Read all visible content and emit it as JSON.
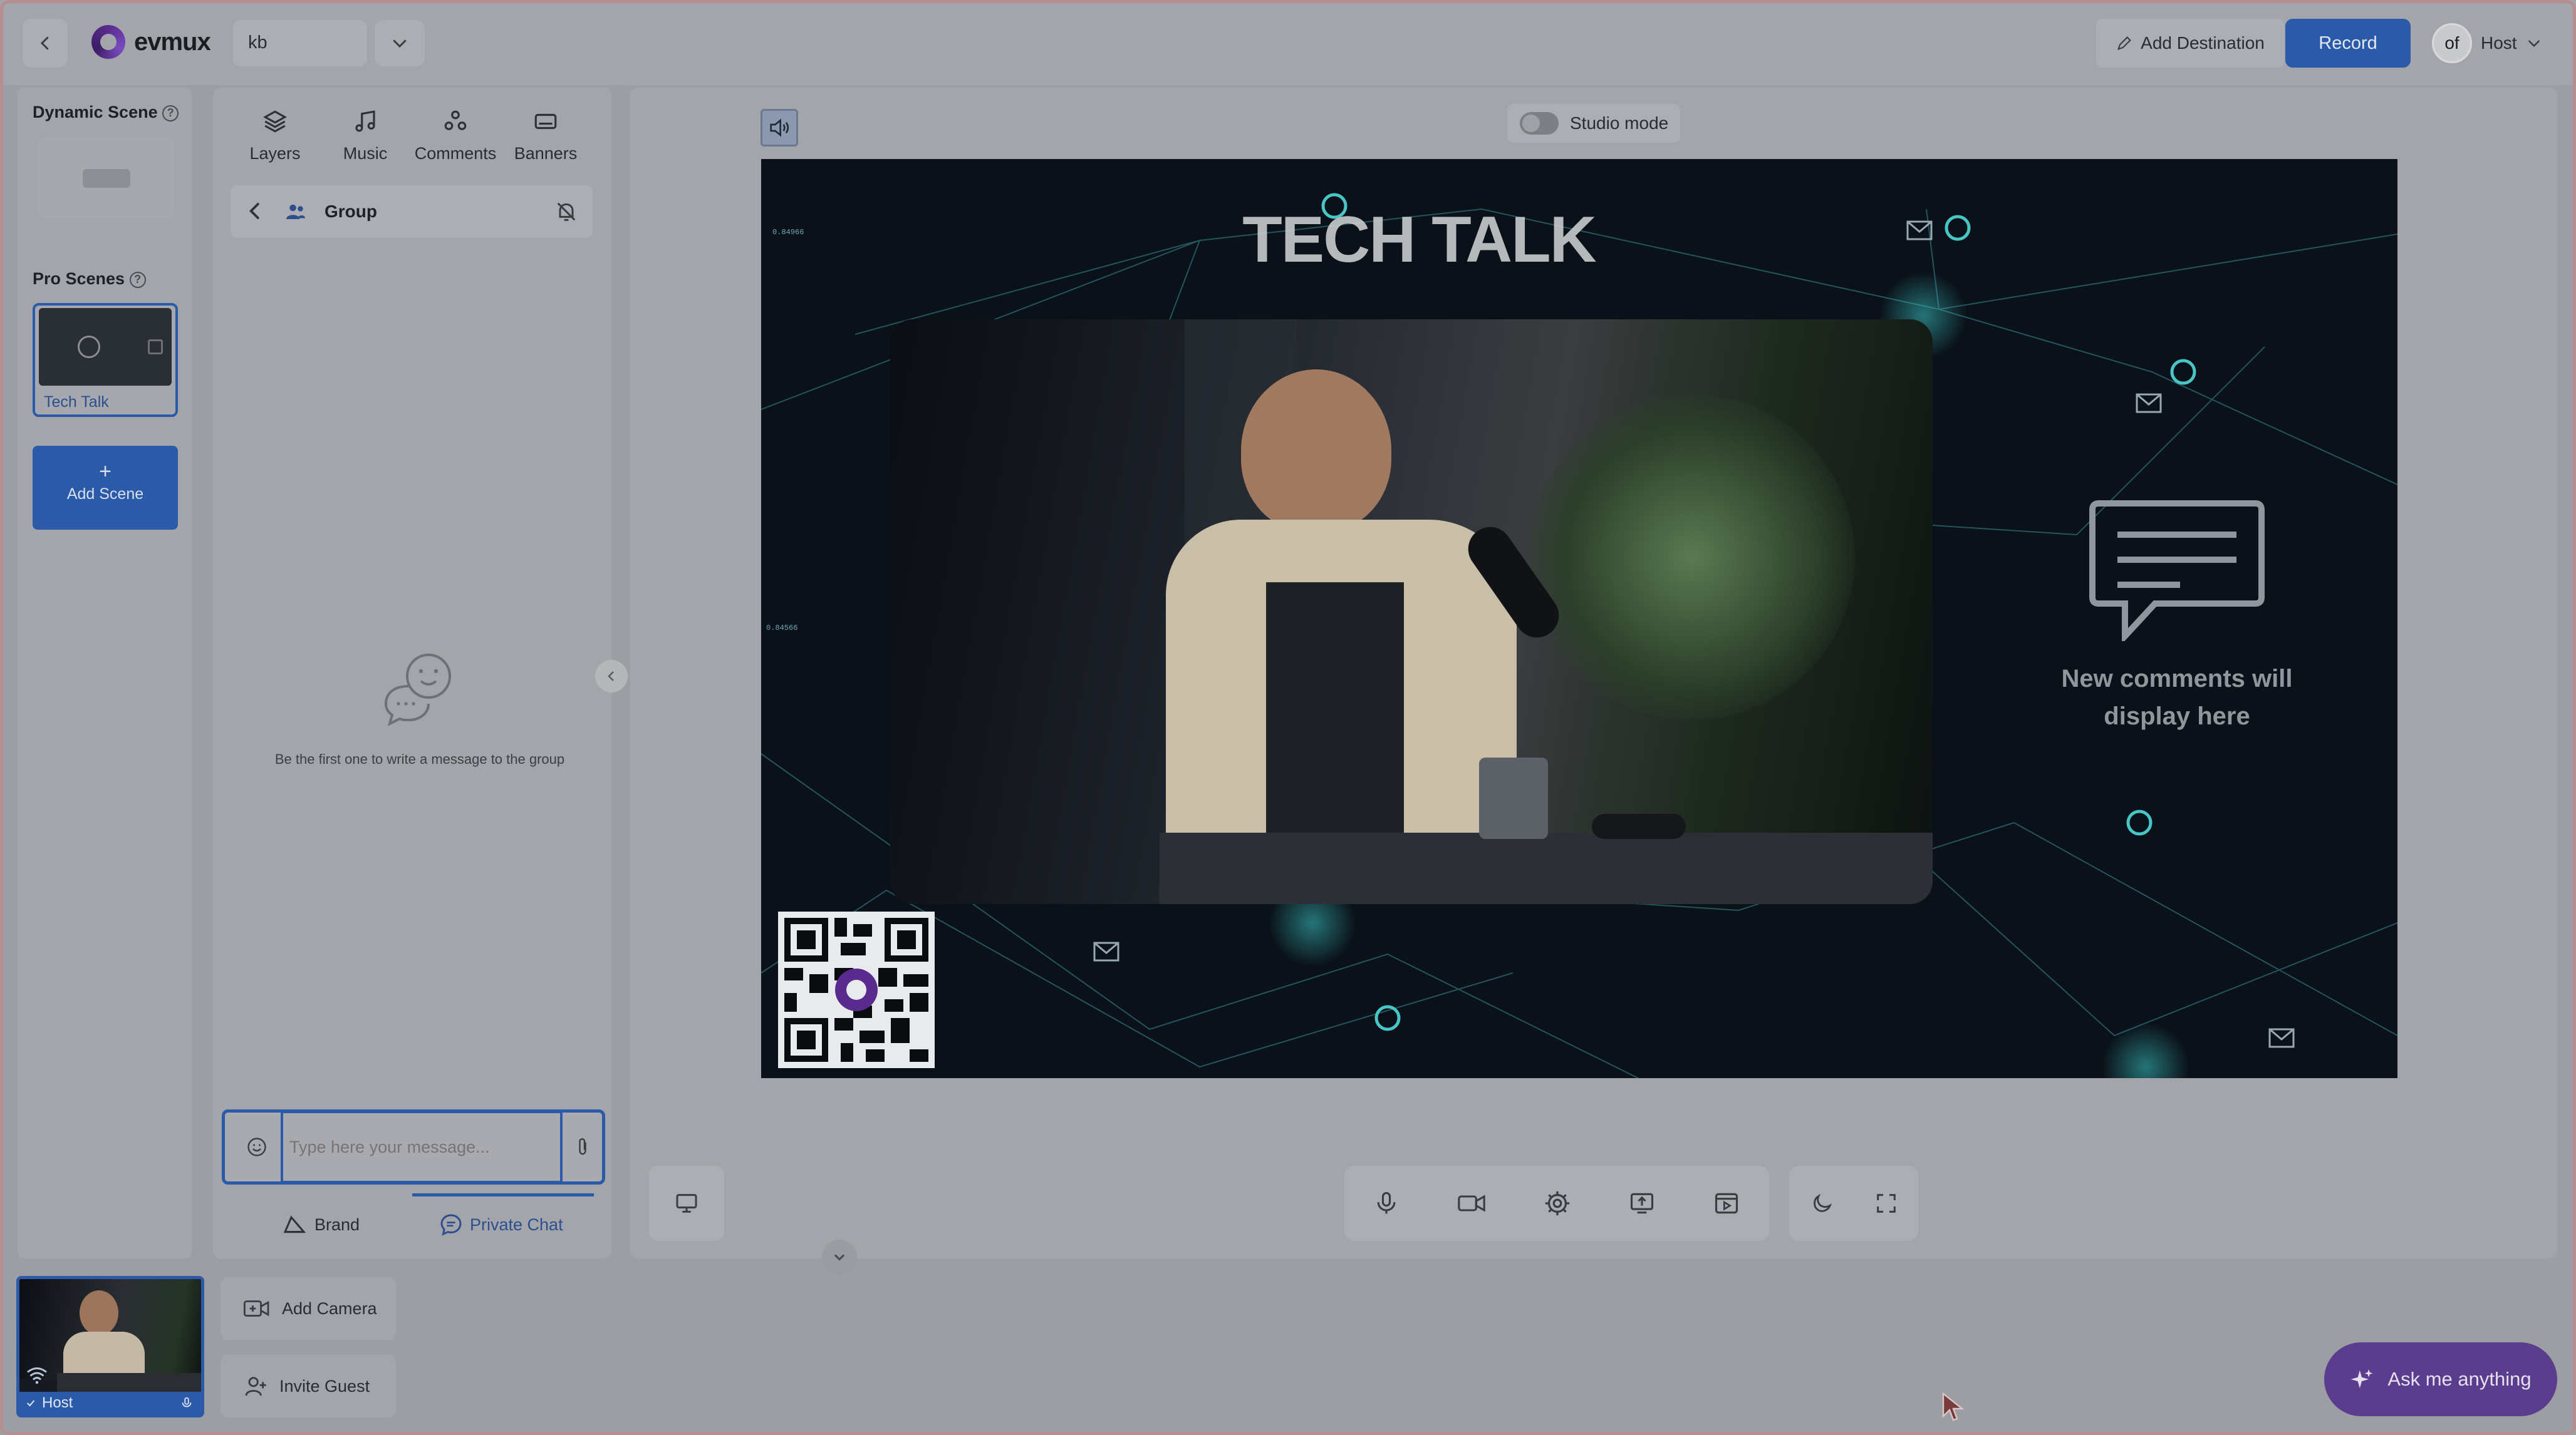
{
  "topbar": {
    "brand": "evmux",
    "workspace_value": "kb",
    "add_destination": "Add Destination",
    "record": "Record",
    "avatar_text": "of",
    "user": "Host"
  },
  "scenes": {
    "dynamic_title": "Dynamic Scene",
    "pro_title": "Pro Scenes",
    "pro_items": [
      {
        "label": "Tech Talk"
      }
    ],
    "add_scene": "Add Scene",
    "add_scene_icon": "+"
  },
  "panel": {
    "tabs": [
      {
        "label": "Layers",
        "icon": "layers-icon"
      },
      {
        "label": "Music",
        "icon": "music-icon"
      },
      {
        "label": "Comments",
        "icon": "comments-icon"
      },
      {
        "label": "Banners",
        "icon": "banners-icon"
      }
    ],
    "group_title": "Group",
    "empty_text": "Be the first one to write a message to the group",
    "message_placeholder": "Type here your message...",
    "bottom_tabs": [
      {
        "label": "Brand",
        "icon": "brand-icon"
      },
      {
        "label": "Private Chat",
        "icon": "chat-icon"
      }
    ]
  },
  "stage": {
    "studio_mode": "Studio mode",
    "title_overlay": "TECH TALK",
    "comments_placeholder": "New comments will display here",
    "data_labels": [
      "0.84966",
      "0.84566"
    ]
  },
  "bottom": {
    "host_label": "Host",
    "add_camera": "Add Camera",
    "invite_guest": "Invite Guest",
    "ask": "Ask me anything"
  },
  "colors": {
    "accent": "#2b5aa8",
    "ask_button": "#5a3d8c",
    "overlay_bg": "#a3a5aa"
  }
}
